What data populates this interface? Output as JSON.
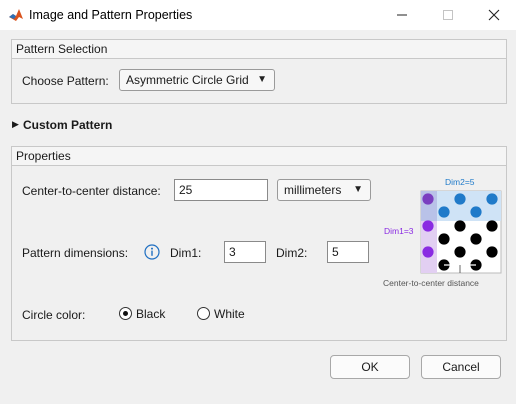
{
  "window": {
    "title": "Image and Pattern Properties",
    "icon": "matlab-logo-icon"
  },
  "pattern_selection": {
    "header": "Pattern Selection",
    "choose_label": "Choose Pattern:",
    "selected": "Asymmetric Circle Grid"
  },
  "custom_pattern": {
    "label": "Custom Pattern",
    "expanded": false
  },
  "properties": {
    "header": "Properties",
    "distance_label": "Center-to-center distance:",
    "distance_value": "25",
    "units_selected": "millimeters",
    "dimensions_label": "Pattern dimensions:",
    "dim1_label": "Dim1:",
    "dim1_value": "3",
    "dim2_label": "Dim2:",
    "dim2_value": "5",
    "color_label": "Circle color:",
    "color_options": [
      "Black",
      "White"
    ],
    "color_selected": "Black"
  },
  "diagram": {
    "dim2_label": "Dim2=5",
    "dim1_label": "Dim1=3",
    "distance_label": "Center-to-center distance",
    "colors": {
      "dim1": "#8a2be2",
      "dim2": "#1f7ac9",
      "dot": "#000000"
    }
  },
  "buttons": {
    "ok": "OK",
    "cancel": "Cancel"
  }
}
